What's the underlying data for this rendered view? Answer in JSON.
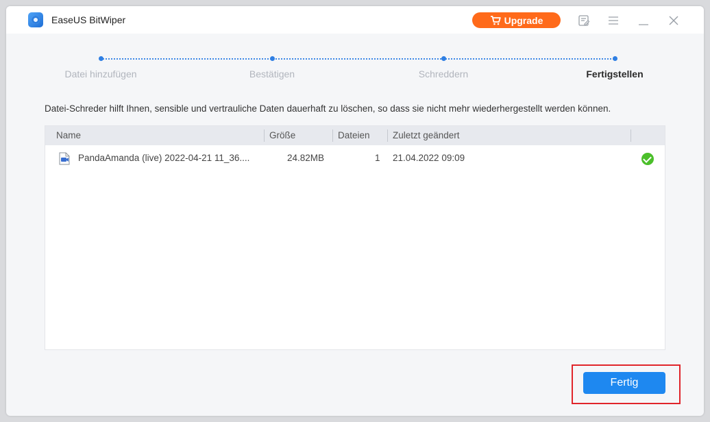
{
  "app": {
    "title": "EaseUS BitWiper"
  },
  "toolbar": {
    "upgrade_label": "Upgrade",
    "icons": [
      "cart-icon",
      "feedback-icon",
      "menu-icon",
      "minimize-icon",
      "close-icon"
    ]
  },
  "steps": [
    {
      "label": "Datei hinzufügen",
      "active": false
    },
    {
      "label": "Bestätigen",
      "active": false
    },
    {
      "label": "Schreddern",
      "active": false
    },
    {
      "label": "Fertigstellen",
      "active": true
    }
  ],
  "description": "Datei-Schreder hilft Ihnen, sensible und vertrauliche Daten dauerhaft zu löschen, so dass sie nicht mehr wiederhergestellt werden können.",
  "table": {
    "columns": [
      "Name",
      "Größe",
      "Dateien",
      "Zuletzt geändert"
    ],
    "rows": [
      {
        "name": "PandaAmanda (live) 2022-04-21 11_36....",
        "size": "24.82MB",
        "files": "1",
        "modified": "21.04.2022 09:09",
        "status": "check-icon"
      }
    ]
  },
  "footer": {
    "done_label": "Fertig"
  },
  "colors": {
    "accent": "#1e88f0",
    "upgrade": "#ff6a1a",
    "success": "#4bbf2a",
    "highlight": "#e0242a"
  }
}
